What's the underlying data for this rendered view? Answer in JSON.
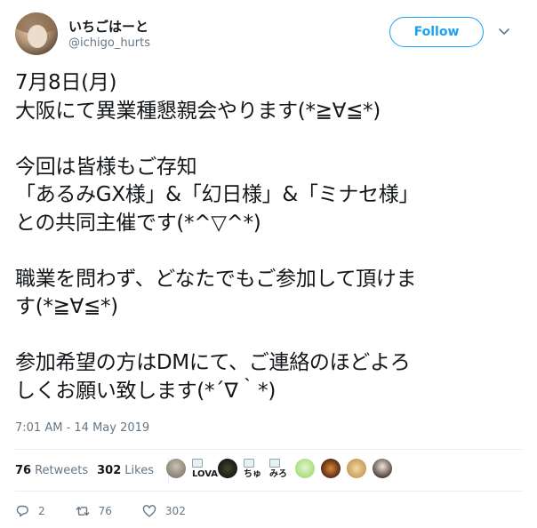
{
  "user": {
    "display_name": "いちごはーと",
    "handle": "@ichigo_hurts"
  },
  "follow_label": "Follow",
  "tweet": {
    "text": "7月8日(月)\n大阪にて異業種懇親会やります(*≧∀≦*)\n\n今回は皆様もご存知\n「あるみGX様」&「幻日様」&「ミナセ様」\nとの共同主催です(*^▽^*)\n\n職業を問わず、どなたでもご参加して頂けま\nす(*≧∀≦*)\n\n参加希望の方はDMにて、ご連絡のほどよろ\nしくお願い致します(*´∇｀*)",
    "timestamp": "7:01 AM - 14 May 2019"
  },
  "stats": {
    "retweets_count": "76",
    "retweets_label": "Retweets",
    "likes_count": "302",
    "likes_label": "Likes"
  },
  "likers": {
    "broken_labels": [
      "LOVALON",
      "ちゅ",
      "みろ"
    ]
  },
  "actions": {
    "reply_count": "2",
    "retweet_count": "76",
    "like_count": "302"
  },
  "colors": {
    "accent": "#1da1f2",
    "muted": "#657786",
    "text": "#14171a"
  },
  "icons": {
    "chevron": "chevron-down-icon",
    "reply": "reply-icon",
    "retweet": "retweet-icon",
    "like": "heart-icon"
  }
}
